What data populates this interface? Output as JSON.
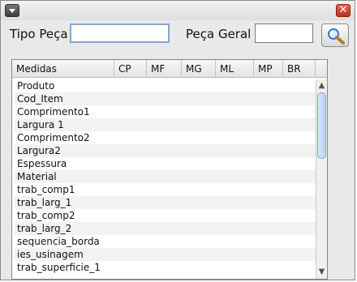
{
  "labels": {
    "tipo_peca": "Tipo Peça",
    "peca_geral": "Peça Geral"
  },
  "inputs": {
    "tipo_peca_value": "",
    "peca_geral_value": ""
  },
  "table": {
    "columns": [
      "Medidas",
      "CP",
      "MF",
      "MG",
      "ML",
      "MP",
      "BR"
    ],
    "rows": [
      "Produto",
      "Cod_Item",
      "Comprimento1",
      "Largura 1",
      "Comprimento2",
      "Largura2",
      "Espessura",
      "Material",
      "trab_comp1",
      "trab_larg_1",
      "trab_comp2",
      "trab_larg_2",
      "sequencia_borda",
      "ies_usinagem",
      "trab_superficie_1"
    ]
  },
  "window": {
    "close_glyph": "✕"
  },
  "scroll": {
    "up": "▲",
    "down": "▼"
  },
  "colors": {
    "accent": "#8aa5c8",
    "close": "#d14b39",
    "menu": "#555555"
  }
}
